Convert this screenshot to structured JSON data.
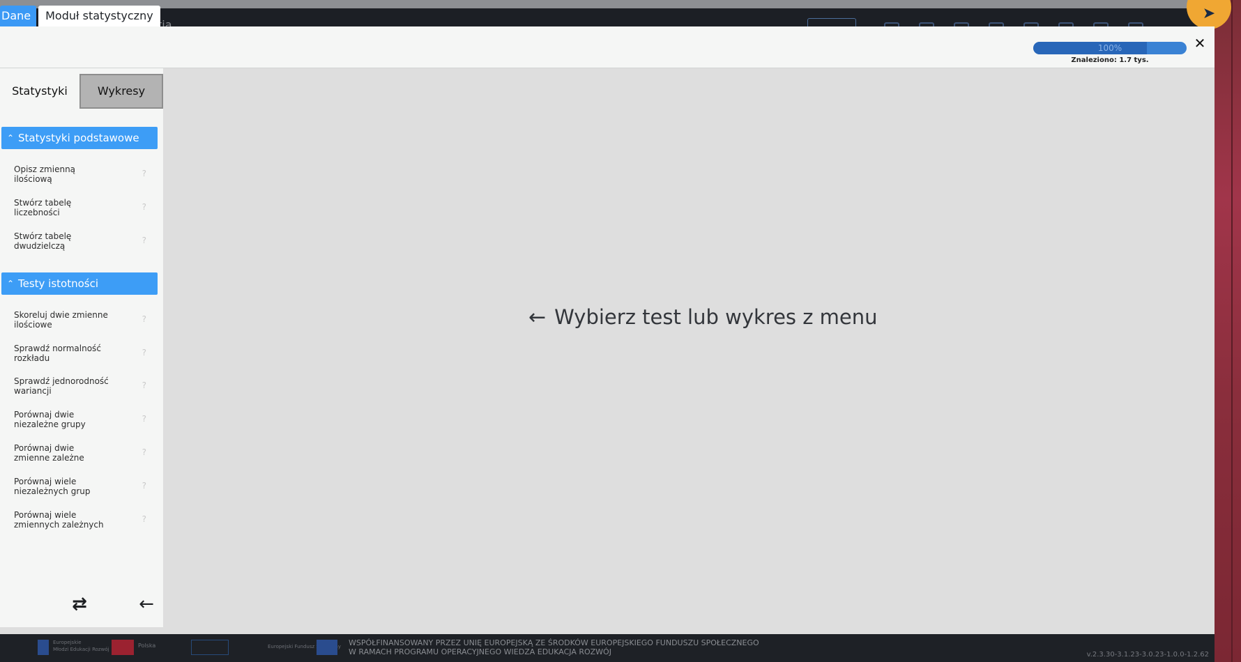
{
  "background": {
    "ghost_text": "tia",
    "footer": {
      "eu_small": "Europejskie",
      "eu_small2": "Młodzi Edukacji Rozwój",
      "pl_label": "Polska",
      "efs_small": "Europejski Fundusz Społeczny",
      "cofund_line1": "WSPÓŁFINANSOWANY PRZEZ UNIĘ EUROPEJSKĄ ZE ŚRODKÓW EUROPEJSKIEGO FUNDUSZU SPOŁECZNEGO",
      "cofund_line2": "W RAMACH PROGRAMU OPERACYJNEGO WIEDZA EDUKACJA ROZWÓJ",
      "version": "v.2.3.30-3.1.23-3.0.23-1.0.0-1.2.62"
    },
    "send_icon": "paper-plane-icon"
  },
  "modal": {
    "tabs": [
      "Dane",
      "Moduł statystyczny"
    ],
    "progress": {
      "percent": 100,
      "label": "100%",
      "found": "Znaleziono: 1.7 tys."
    },
    "close_label": "✕"
  },
  "sidebar": {
    "tabs": [
      "Statystyki",
      "Wykresy"
    ],
    "sections": [
      {
        "title": "Statystyki podstawowe",
        "items": [
          {
            "line1": "Opisz zmienną",
            "line2": "ilościową"
          },
          {
            "line1": "Stwórz tabelę",
            "line2": "liczebności"
          },
          {
            "line1": "Stwórz tabelę",
            "line2": "dwudzielczą"
          }
        ]
      },
      {
        "title": "Testy istotności",
        "items": [
          {
            "line1": "Skoreluj dwie zmienne",
            "line2": "ilościowe"
          },
          {
            "line1": "Sprawdź normalność",
            "line2": "rozkładu"
          },
          {
            "line1": "Sprawdź jednorodność",
            "line2": "wariancji"
          },
          {
            "line1": "Porównaj dwie",
            "line2": "niezależne grupy"
          },
          {
            "line1": "Porównaj dwie",
            "line2": "zmienne zależne"
          },
          {
            "line1": "Porównaj wiele",
            "line2": "niezależnych grup"
          },
          {
            "line1": "Porównaj wiele",
            "line2": "zmiennych zależnych"
          }
        ]
      }
    ],
    "help_glyph": "?",
    "swap_glyph": "⇄",
    "collapse_glyph": "←"
  },
  "main": {
    "placeholder_arrow": "←",
    "placeholder_text": "Wybierz test lub wykres z menu"
  }
}
